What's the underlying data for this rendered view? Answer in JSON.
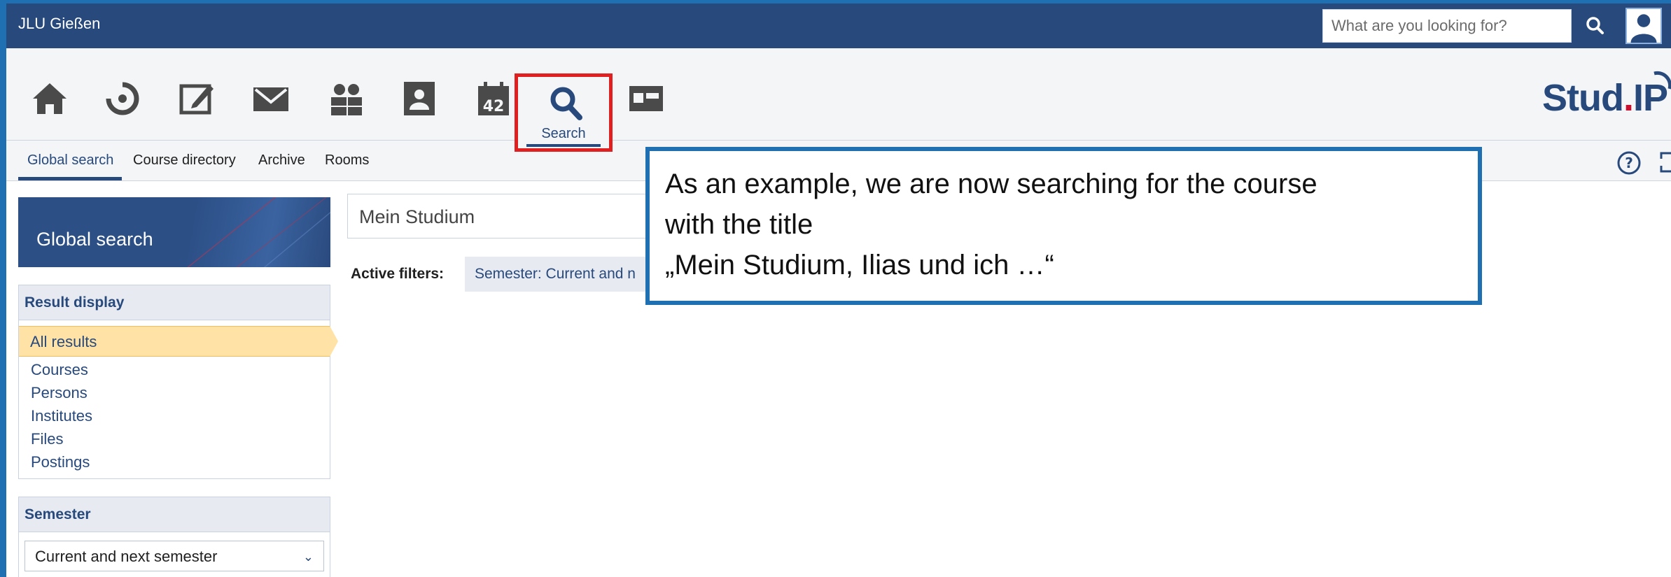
{
  "topbar": {
    "brand": "JLU Gießen",
    "search_placeholder": "What are you looking for?"
  },
  "nav": {
    "items": [
      "home-icon",
      "activity-icon",
      "courses-icon",
      "messages-icon",
      "community-icon",
      "profile-icon",
      "schedule-icon",
      "search-icon",
      "tools-icon"
    ],
    "schedule_day": "42",
    "search_label": "Search",
    "logo_main": "Stud",
    "logo_dot": ".",
    "logo_ip": "IP"
  },
  "tabs": [
    "Global search",
    "Course directory",
    "Archive",
    "Rooms"
  ],
  "sidebar": {
    "title": "Global search",
    "result_display": {
      "heading": "Result display",
      "active": "All results",
      "items": [
        "Courses",
        "Persons",
        "Institutes",
        "Files",
        "Postings"
      ]
    },
    "semester": {
      "heading": "Semester",
      "selected": "Current and next semester"
    }
  },
  "main": {
    "query": "Mein Studium",
    "filters_label": "Active filters:",
    "filter_chip": "Semester: Current and n"
  },
  "callout": {
    "lines": [
      "As an example, we are now searching for the course",
      "with the title",
      "„Mein Studium, Ilias und ich …“"
    ]
  },
  "colors": {
    "header_blue": "#28497c",
    "accent_red": "#e02020",
    "active_yellow": "#ffe3a6",
    "callout_border": "#1f6fb3"
  }
}
